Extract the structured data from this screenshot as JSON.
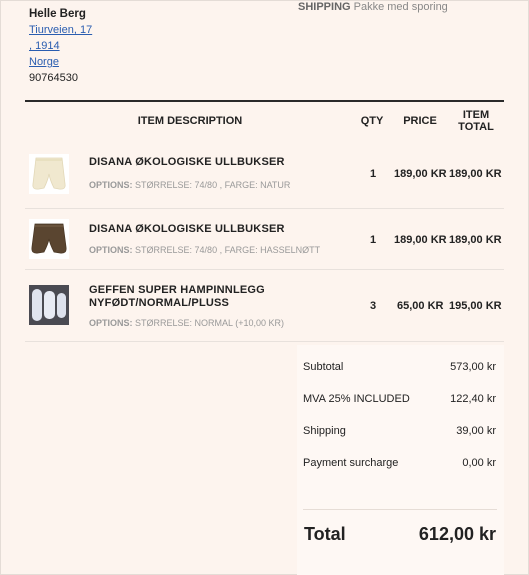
{
  "customer": {
    "name": "Helle Berg",
    "street": "Tiurveien, 17",
    "postcode": ", 1914",
    "country": "Norge",
    "phone": "90764530"
  },
  "shipping": {
    "label": "SHIPPING",
    "method": "Pakke med sporing"
  },
  "table": {
    "headers": {
      "description": "ITEM DESCRIPTION",
      "qty": "QTY",
      "price": "PRICE",
      "total_line1": "ITEM",
      "total_line2": "TOTAL"
    },
    "items": [
      {
        "name": "DISANA ØKOLOGISKE ULLBUKSER",
        "options_label": "OPTIONS:",
        "options": "STØRRELSE: 74/80 ,  FARGE: NATUR",
        "qty": "1",
        "price": "189,00 KR",
        "total": "189,00 KR",
        "thumb_icon": "cream-wool-pants-image"
      },
      {
        "name": "DISANA ØKOLOGISKE ULLBUKSER",
        "options_label": "OPTIONS:",
        "options": "STØRRELSE: 74/80 ,  FARGE: HASSELNØTT",
        "qty": "1",
        "price": "189,00 KR",
        "total": "189,00 KR",
        "thumb_icon": "brown-wool-pants-image"
      },
      {
        "name_line1": "GEFFEN SUPER HAMPINNLEGG",
        "name_line2": "NYFØDT/NORMAL/PLUSS",
        "options_label": "OPTIONS:",
        "options": "STØRRELSE: NORMAL  (+10,00 KR)",
        "qty": "3",
        "price": "65,00 KR",
        "total": "195,00 KR",
        "thumb_icon": "hemp-inserts-image"
      }
    ]
  },
  "summary": {
    "subtotal_label": "Subtotal",
    "subtotal": "573,00 kr",
    "vat_label": "MVA 25% INCLUDED",
    "vat": "122,40 kr",
    "shipping_label": "Shipping",
    "shipping": "39,00 kr",
    "surcharge_label": "Payment surcharge",
    "surcharge": "0,00 kr",
    "total_label": "Total",
    "total": "612,00 kr"
  },
  "colors": {
    "background": "#fdf4ee",
    "link": "#2a5db0",
    "rule": "#2a2a2a"
  }
}
